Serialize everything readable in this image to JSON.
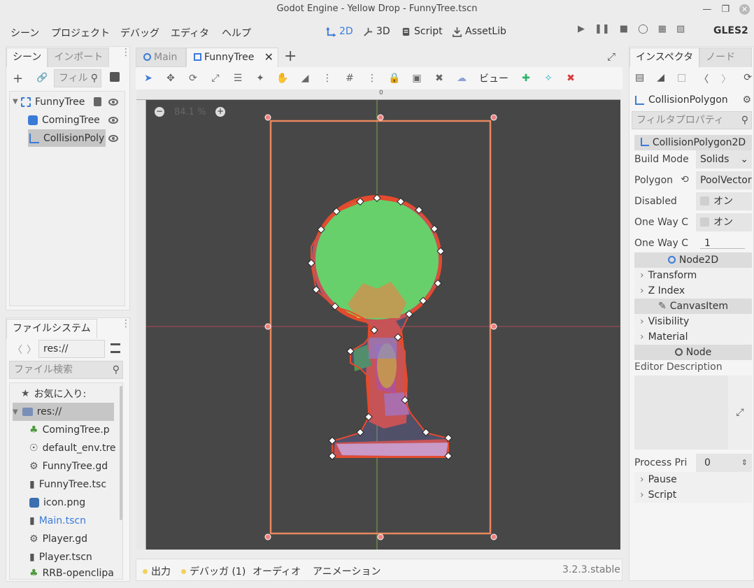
{
  "window": {
    "title": "Godot Engine - Yellow Drop - FunnyTree.tscn"
  },
  "menu": [
    "シーン",
    "プロジェクト",
    "デバッグ",
    "エディタ",
    "ヘルプ"
  ],
  "workspaces": {
    "w2d": "2D",
    "w3d": "3D",
    "script": "Script",
    "assetlib": "AssetLib"
  },
  "renderer": "GLES2",
  "scene_dock": {
    "tabs": [
      "シーン",
      "インポート"
    ],
    "filter_placeholder": "フィル",
    "tree": [
      {
        "label": "FunnyTree"
      },
      {
        "label": "ComingTree"
      },
      {
        "label": "CollisionPoly"
      }
    ]
  },
  "filesystem": {
    "tab": "ファイルシステム",
    "path": "res://",
    "search_placeholder": "ファイル検索",
    "favorites": "お気に入り:",
    "root": "res://",
    "files": [
      {
        "name": "ComingTree.p",
        "icon": "tree-scene-icon"
      },
      {
        "name": "default_env.tre",
        "icon": "globe-icon"
      },
      {
        "name": "FunnyTree.gd",
        "icon": "gear-icon"
      },
      {
        "name": "FunnyTree.tsc",
        "icon": "clapper-icon"
      },
      {
        "name": "icon.png",
        "icon": "image-icon"
      },
      {
        "name": "Main.tscn",
        "icon": "clapper-icon"
      },
      {
        "name": "Player.gd",
        "icon": "gear-icon"
      },
      {
        "name": "Player.tscn",
        "icon": "clapper-icon"
      },
      {
        "name": "RRB-openclipa",
        "icon": "tree-scene-icon"
      }
    ]
  },
  "editor_tabs": [
    {
      "label": "Main"
    },
    {
      "label": "FunnyTree"
    }
  ],
  "toolbar": {
    "view_label": "ビュー"
  },
  "viewport": {
    "zoom": "84.1 %",
    "ruler_zero": "0"
  },
  "bottom": {
    "output": "出力",
    "debugger": "デバッガ (1)",
    "audio": "オーディオ",
    "animation": "アニメーション",
    "version": "3.2.3.stable"
  },
  "inspector": {
    "tabs": [
      "インスペクタ",
      "ノード"
    ],
    "node_name": "CollisionPolygon",
    "filter_placeholder": "フィルタプロパティ",
    "class_header": "CollisionPolygon2D",
    "properties": {
      "build_mode": {
        "label": "Build Mode",
        "value": "Solids"
      },
      "polygon": {
        "label": "Polygon",
        "value": "PoolVector"
      },
      "disabled": {
        "label": "Disabled",
        "value": "オン"
      },
      "one_way": {
        "label": "One Way C",
        "value": "オン"
      },
      "one_way_margin": {
        "label": "One Way C",
        "value": "1"
      }
    },
    "node2d_header": "Node2D",
    "transform": "Transform",
    "zindex": "Z Index",
    "canvasitem_header": "CanvasItem",
    "visibility": "Visibility",
    "material": "Material",
    "node_header": "Node",
    "editor_description": "Editor Description",
    "process_priority": {
      "label": "Process Pri",
      "value": "0"
    },
    "pause": "Pause",
    "script": "Script"
  }
}
